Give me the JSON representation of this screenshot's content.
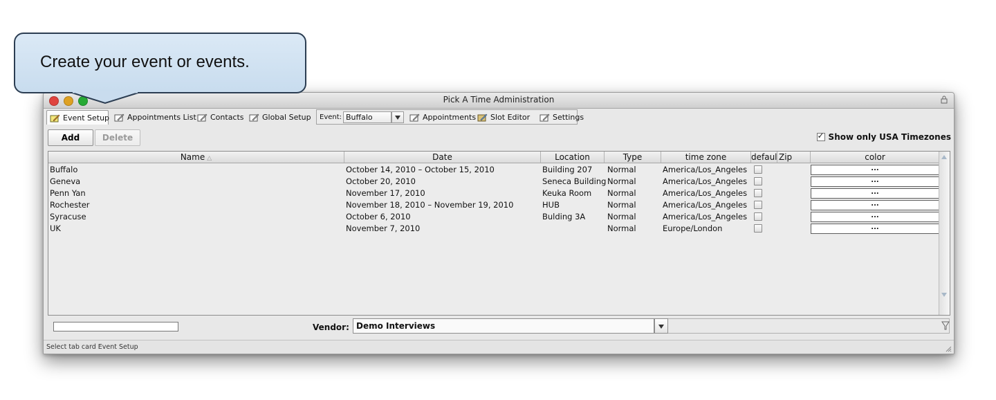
{
  "callout": {
    "text": "Create your event or events."
  },
  "window": {
    "title": "Pick A Time Administration"
  },
  "tabs": [
    {
      "label": "Event Setup",
      "icon": "edit-card-icon"
    },
    {
      "label": "Appointments List",
      "icon": "list-card-icon"
    },
    {
      "label": "Contacts",
      "icon": "contacts-card-icon"
    },
    {
      "label": "Global Setup",
      "icon": "global-card-icon"
    }
  ],
  "event_group": {
    "label": "Event:",
    "selected": "Buffalo",
    "tabs": [
      {
        "label": "Appointments",
        "icon": "appointments-card-icon"
      },
      {
        "label": "Slot Editor",
        "icon": "slot-editor-icon"
      },
      {
        "label": "Settings",
        "icon": "settings-card-icon"
      }
    ]
  },
  "toolbar": {
    "add_label": "Add",
    "delete_label": "Delete"
  },
  "usa_filter": {
    "label": "Show only USA Timezones",
    "checked": true
  },
  "table": {
    "columns": [
      "Name",
      "Date",
      "Location",
      "Type",
      "time zone",
      "default",
      "Zip",
      "color"
    ],
    "color_button_label": "...",
    "rows": [
      {
        "name": "Buffalo",
        "date": "October 14, 2010 – October 15, 2010",
        "location": "Building 207",
        "type": "Normal",
        "timezone": "America/Los_Angeles",
        "zip": ""
      },
      {
        "name": "Geneva",
        "date": "October 20, 2010",
        "location": "Seneca Building",
        "type": "Normal",
        "timezone": "America/Los_Angeles",
        "zip": ""
      },
      {
        "name": "Penn Yan",
        "date": "November 17, 2010",
        "location": "Keuka Room",
        "type": "Normal",
        "timezone": "America/Los_Angeles",
        "zip": ""
      },
      {
        "name": "Rochester",
        "date": "November 18, 2010 – November 19, 2010",
        "location": "HUB",
        "type": "Normal",
        "timezone": "America/Los_Angeles",
        "zip": ""
      },
      {
        "name": "Syracuse",
        "date": "October 6, 2010",
        "location": "Bulding 3A",
        "type": "Normal",
        "timezone": "America/Los_Angeles",
        "zip": ""
      },
      {
        "name": "UK",
        "date": "November 7, 2010",
        "location": "",
        "type": "Normal",
        "timezone": "Europe/London",
        "zip": ""
      }
    ]
  },
  "vendor": {
    "label": "Vendor:",
    "selected": "Demo Interviews"
  },
  "status": {
    "text": "Select tab card Event Setup"
  }
}
